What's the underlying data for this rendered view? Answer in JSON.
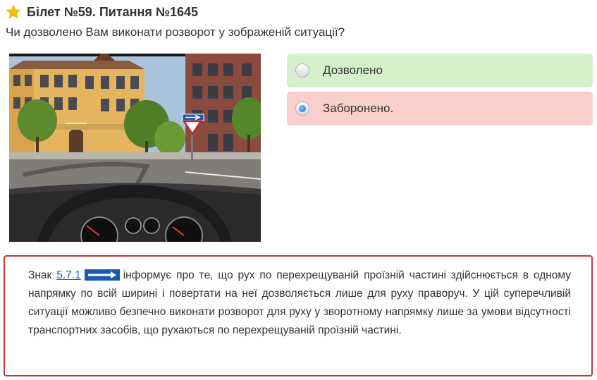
{
  "header": {
    "title": "Білет №59. Питання №1645",
    "star_icon": "star-icon",
    "star_color": "#f2c200"
  },
  "question": {
    "text": "Чи дозволено Вам виконати розворот у зображеній ситуації?"
  },
  "answers": [
    {
      "label": "Дозволено",
      "selected": false,
      "color": "#d4f1cc"
    },
    {
      "label": "Заборонено.",
      "selected": true,
      "color": "#f8cfca"
    }
  ],
  "explanation": {
    "prefix": "Знак",
    "link_text": "5.7.1",
    "sign_icon": "one-way-road-sign-icon",
    "text": "інформує про те, що рух по перехрещуваній проїзній частині здійснюється в одному напрямку по всій ширині і повертати на неї дозволяється лише для руху праворуч. У цій суперечливій ситуації можливо безпечно виконати розворот для руху у зворотному напрямку лише за умови відсутності транспортних засобів, що рухаються по перехрещуваній проїзній частині.",
    "border_color": "#c0393b"
  }
}
